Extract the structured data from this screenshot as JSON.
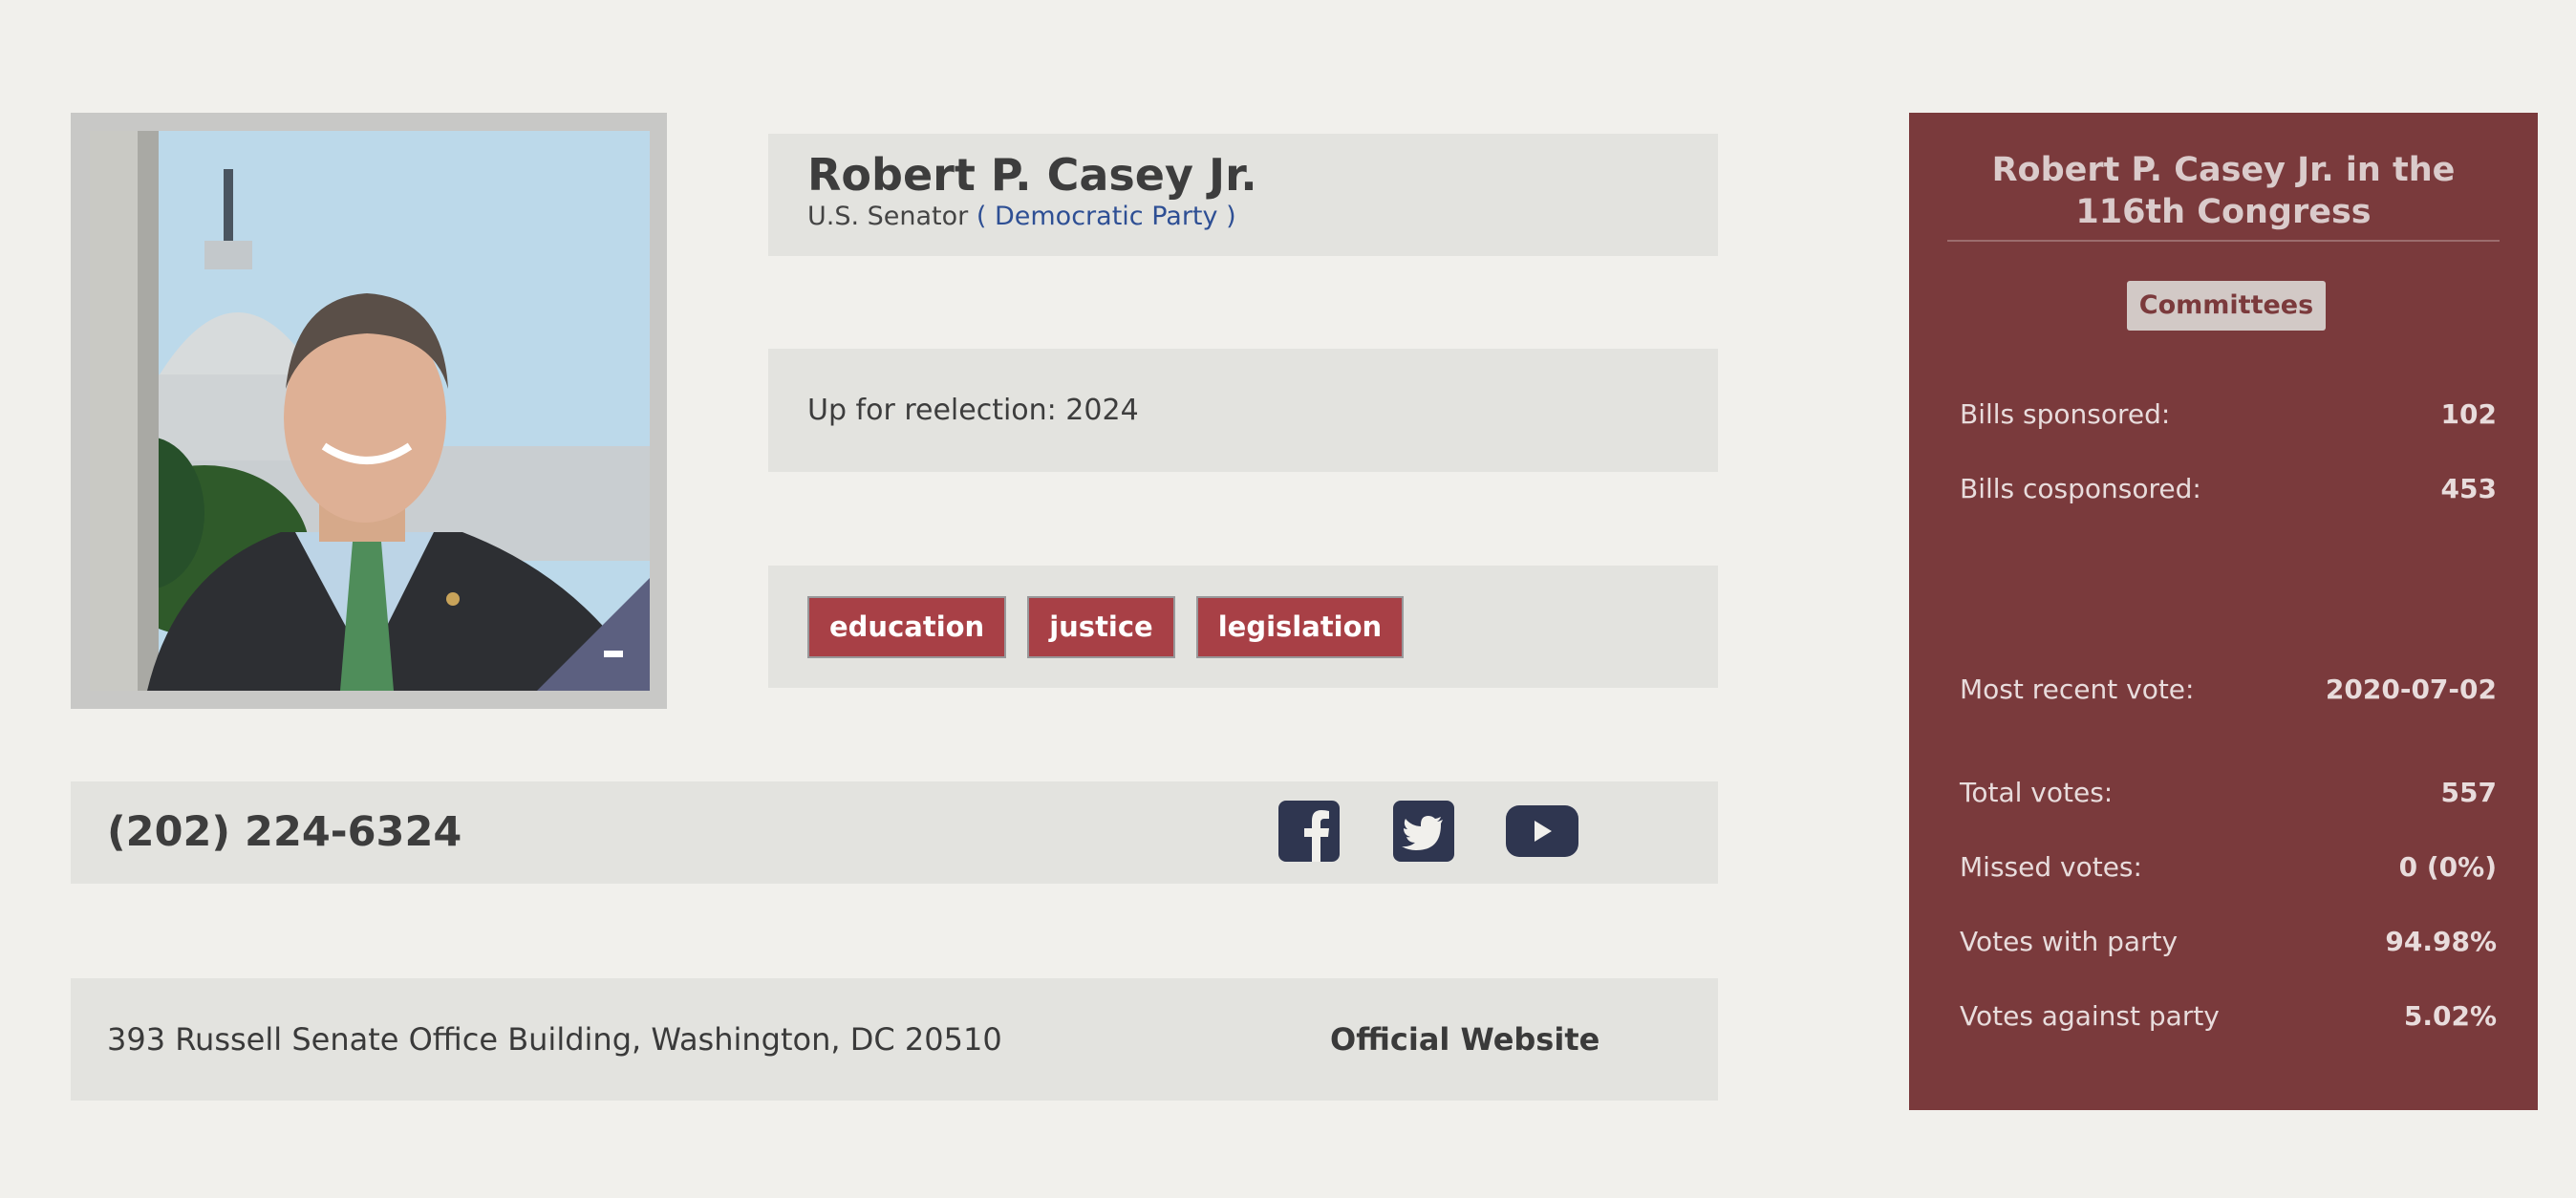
{
  "profile": {
    "name": "Robert P. Casey Jr.",
    "role": "U.S. Senator",
    "party": "( Democratic Party )",
    "reelection": "Up for reelection: 2024",
    "tags": [
      "education",
      "justice",
      "legislation"
    ],
    "phone": "(202) 224-6324",
    "address": "393 Russell Senate Office Building, Washington, DC 20510",
    "website_label": "Official Website"
  },
  "social": {
    "icons": [
      "facebook-icon",
      "twitter-icon",
      "youtube-icon"
    ]
  },
  "stats": {
    "title": "Robert P. Casey Jr. in the 116th Congress",
    "committees_label": "Committees",
    "rows": [
      {
        "label": "Bills sponsored:",
        "value": "102"
      },
      {
        "label": "Bills cosponsored:",
        "value": "453"
      },
      {
        "label": "Most recent vote:",
        "value": "2020-07-02"
      },
      {
        "label": "Total votes:",
        "value": "557"
      },
      {
        "label": "Missed votes:",
        "value": "0 (0%)"
      },
      {
        "label": "Votes with party",
        "value": "94.98%"
      },
      {
        "label": "Votes against party",
        "value": "5.02%"
      }
    ]
  },
  "colors": {
    "background": "#f1f0ec",
    "panel": "#e3e3df",
    "tag": "#a84046",
    "sidebar": "#7a3a3c",
    "party_link": "#2e4f94",
    "social": "#2f3650"
  }
}
